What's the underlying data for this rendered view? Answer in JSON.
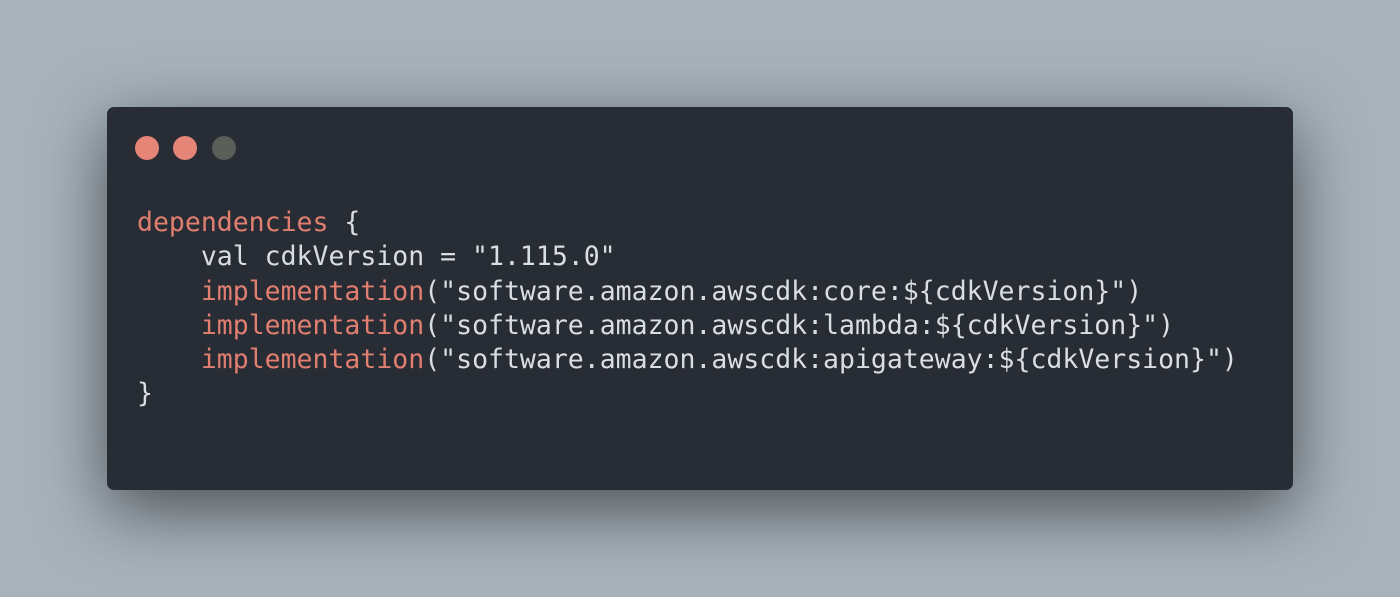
{
  "colors": {
    "background": "#a7b2bb",
    "window": "#282c34",
    "text": "#d9dde4",
    "keyword": "#e07e70",
    "dot_close": "#e58577",
    "dot_minimize": "#e58577",
    "dot_maximize": "#5a5d58"
  },
  "window_controls": [
    {
      "name": "close",
      "icon": "circle-dot-icon",
      "color": "#e58577"
    },
    {
      "name": "minimize",
      "icon": "circle-dot-icon",
      "color": "#e58577"
    },
    {
      "name": "maximize",
      "icon": "circle-dot-icon",
      "color": "#5a5d58"
    }
  ],
  "code": {
    "lines": [
      {
        "indent": "",
        "keyword": "dependencies",
        "text": " {"
      },
      {
        "indent": "    ",
        "keyword": "",
        "text": "val cdkVersion = \"1.115.0\""
      },
      {
        "indent": "    ",
        "keyword": "implementation",
        "text": "(\"software.amazon.awscdk:core:${cdkVersion}\")"
      },
      {
        "indent": "    ",
        "keyword": "implementation",
        "text": "(\"software.amazon.awscdk:lambda:${cdkVersion}\")"
      },
      {
        "indent": "    ",
        "keyword": "implementation",
        "text": "(\"software.amazon.awscdk:apigateway:${cdkVersion}\")"
      },
      {
        "indent": "",
        "keyword": "",
        "text": "}"
      }
    ]
  }
}
